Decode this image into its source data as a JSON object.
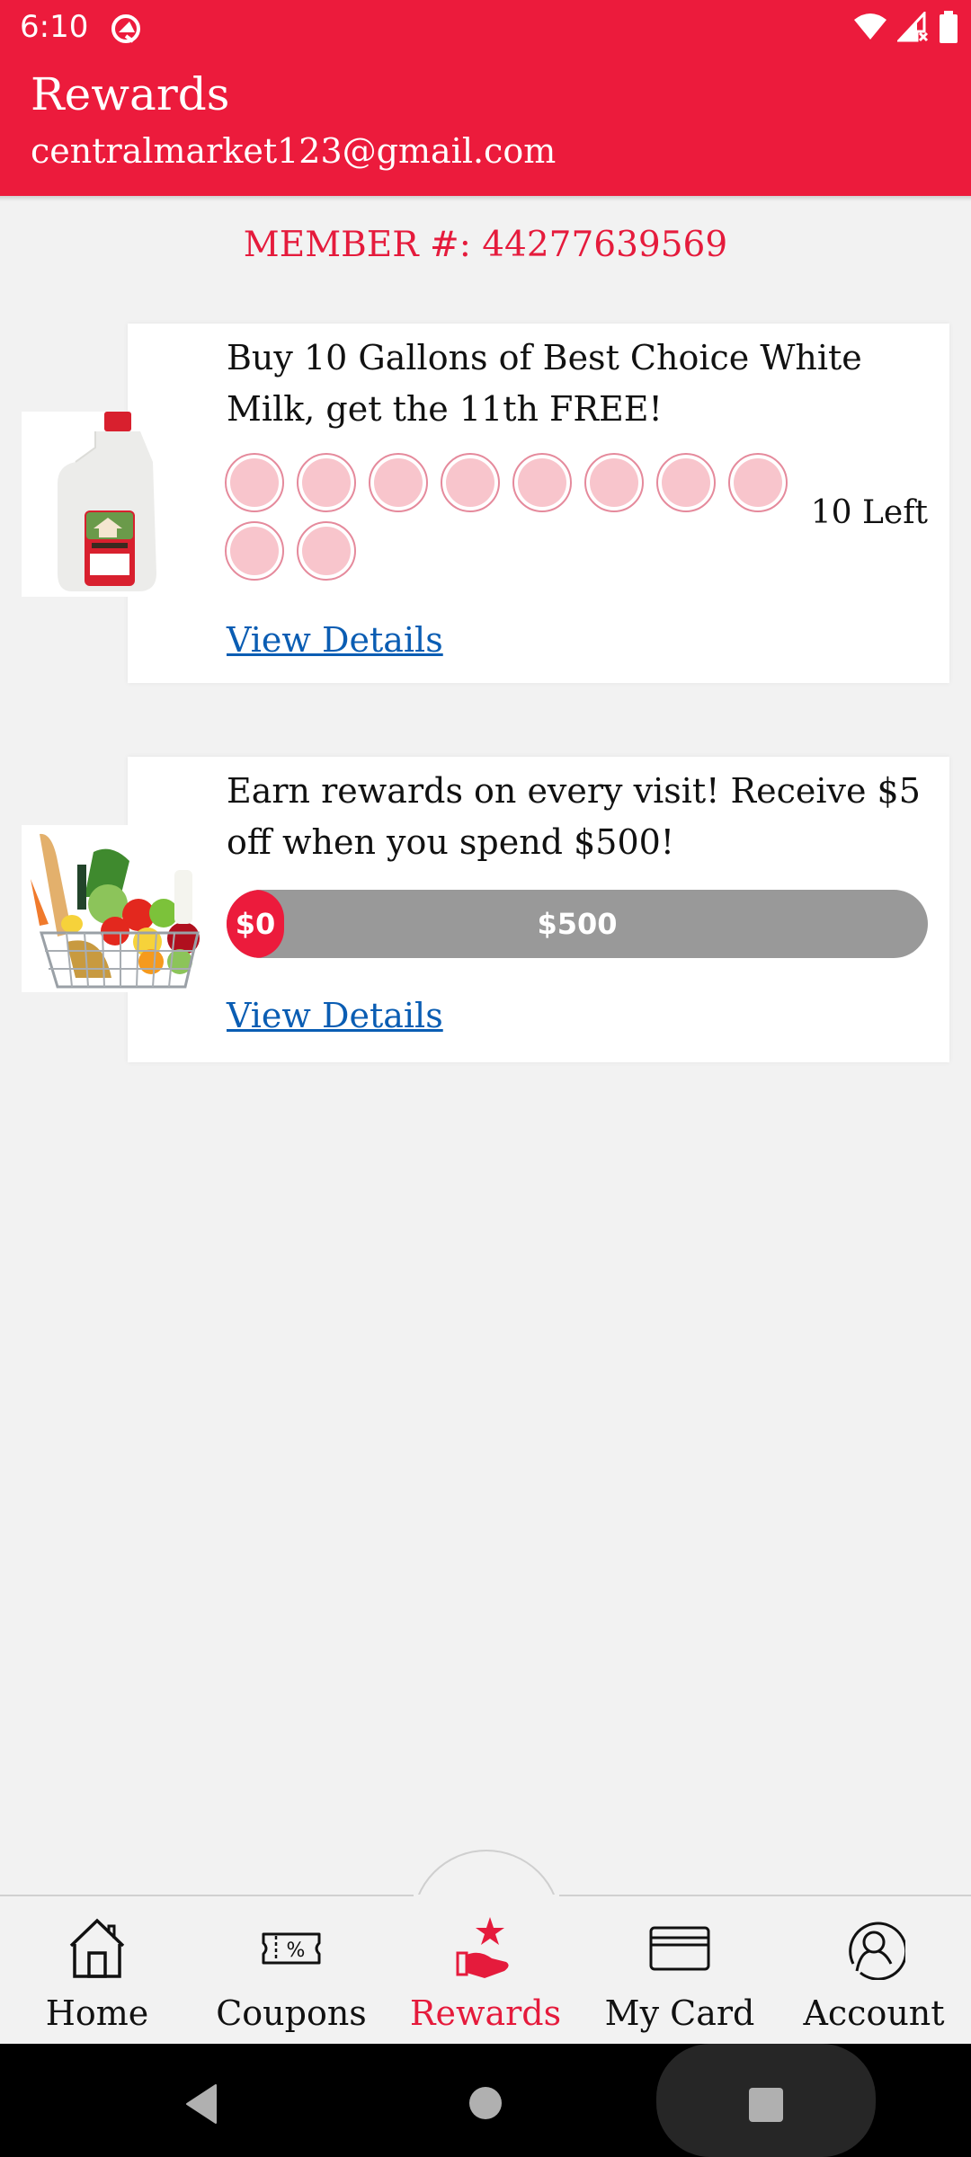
{
  "status_bar": {
    "time": "6:10",
    "left_icons": [
      "app-notification-icon"
    ],
    "right_icons": [
      "wifi-icon",
      "cellular-no-signal-icon",
      "battery-icon"
    ]
  },
  "header": {
    "title": "Rewards",
    "email": "centralmarket123@gmail.com",
    "brand_color": "#ec1b3c"
  },
  "member": {
    "label": "MEMBER #:",
    "number": "44277639569",
    "full": "MEMBER #: 44277639569"
  },
  "rewards": [
    {
      "type": "punch-card",
      "image": "milk-gallon-image",
      "title": "Buy 10 Gallons of Best Choice White Milk, get the 11th FREE!",
      "punches_total": 10,
      "punches_filled": 0,
      "remaining_label": "10 Left",
      "link_label": "View Details"
    },
    {
      "type": "spend-progress",
      "image": "grocery-basket-image",
      "title": "Earn rewards on every visit! Receive $5 off when you spend $500!",
      "progress_current": 0,
      "progress_goal": 500,
      "current_label": "$0",
      "goal_label": "$500",
      "link_label": "View Details"
    }
  ],
  "bottom_nav": {
    "active": "Rewards",
    "items": [
      {
        "label": "Home",
        "icon": "home-icon"
      },
      {
        "label": "Coupons",
        "icon": "coupon-ticket-icon"
      },
      {
        "label": "Rewards",
        "icon": "rewards-hand-star-icon"
      },
      {
        "label": "My Card",
        "icon": "card-icon"
      },
      {
        "label": "Account",
        "icon": "account-icon"
      }
    ]
  },
  "system_nav": {
    "buttons": [
      "back-icon",
      "home-circle-icon",
      "recents-icon"
    ]
  }
}
